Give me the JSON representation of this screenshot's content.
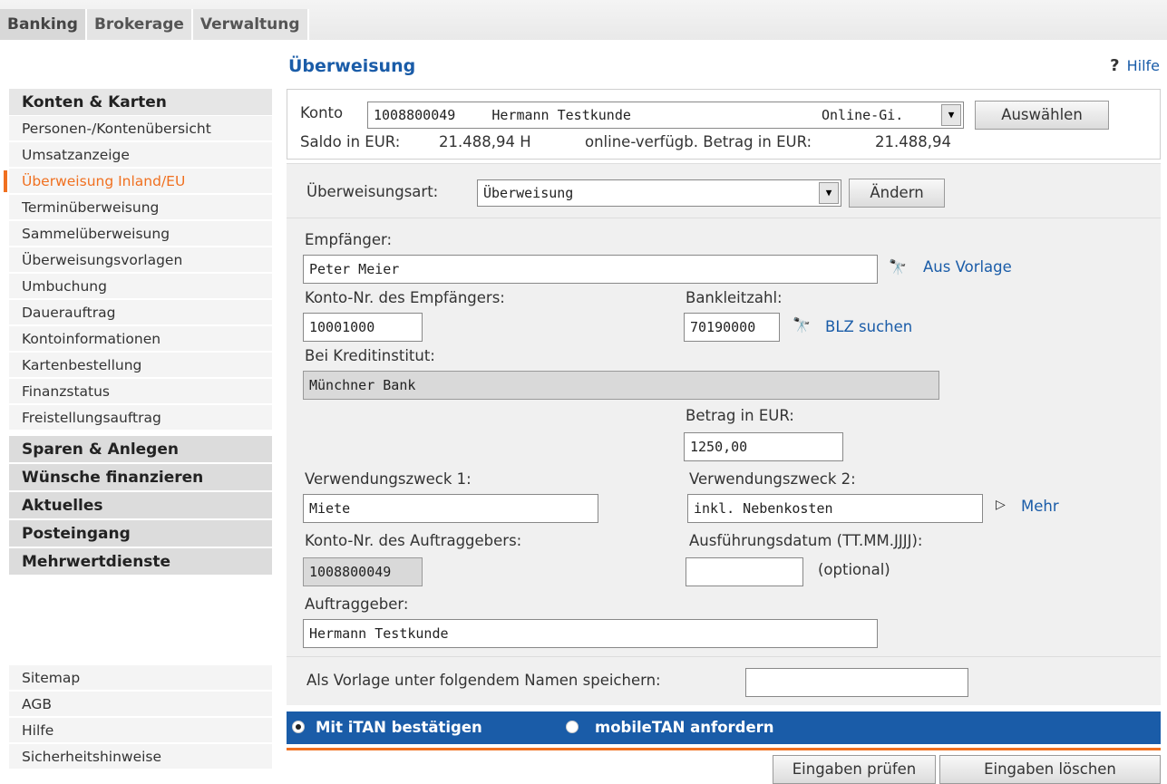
{
  "top_tabs": [
    "Banking",
    "Brokerage",
    "Verwaltung"
  ],
  "sidebar": {
    "category_konten": "Konten & Karten",
    "items": [
      "Personen-/Kontenübersicht",
      "Umsatzanzeige",
      "Überweisung Inland/EU",
      "Terminüberweisung",
      "Sammelüberweisung",
      "Überweisungsvorlagen",
      "Umbuchung",
      "Dauerauftrag",
      "Kontoinformationen",
      "Kartenbestellung",
      "Finanzstatus",
      "Freistellungsauftrag"
    ],
    "categories": [
      "Sparen & Anlegen",
      "Wünsche finanzieren",
      "Aktuelles",
      "Posteingang",
      "Mehrwertdienste"
    ],
    "footer_items": [
      "Sitemap",
      "AGB",
      "Hilfe",
      "Sicherheitshinweise"
    ]
  },
  "page": {
    "title": "Überweisung",
    "help": "Hilfe"
  },
  "konto": {
    "label": "Konto",
    "number": "1008800049",
    "name": "Hermann Testkunde",
    "type": "Online-Gi.",
    "select_button": "Auswählen",
    "saldo_label": "Saldo in EUR:",
    "saldo_value": "21.488,94 H",
    "verfuegbar_label": "online-verfügb. Betrag in EUR:",
    "verfuegbar_value": "21.488,94"
  },
  "art": {
    "label": "Überweisungsart:",
    "value": "Überweisung",
    "button": "Ändern"
  },
  "form": {
    "empfaenger_label": "Empfänger:",
    "empfaenger_value": "Peter Meier",
    "aus_vorlage": "Aus Vorlage",
    "kontonr_label": "Konto-Nr. des Empfängers:",
    "kontonr_value": "10001000",
    "blz_label": "Bankleitzahl:",
    "blz_value": "70190000",
    "blz_suchen": "BLZ suchen",
    "kreditinstitut_label": "Bei Kreditinstitut:",
    "kreditinstitut_value": "Münchner Bank",
    "betrag_label": "Betrag in EUR:",
    "betrag_value": "1250,00",
    "vz1_label": "Verwendungszweck 1:",
    "vz1_value": "Miete",
    "vz2_label": "Verwendungszweck 2:",
    "vz2_value": "inkl. Nebenkosten",
    "mehr": "Mehr",
    "auftraggeber_kto_label": "Konto-Nr. des Auftraggebers:",
    "auftraggeber_kto_value": "1008800049",
    "datum_label": "Ausführungsdatum (TT.MM.JJJJ):",
    "datum_value": "",
    "optional": "(optional)",
    "auftraggeber_label": "Auftraggeber:",
    "auftraggeber_value": "Hermann Testkunde"
  },
  "vorlage": {
    "label": "Als Vorlage unter folgendem Namen speichern:",
    "value": ""
  },
  "tan": {
    "option1": "Mit iTAN bestätigen",
    "option2": "mobileTAN anfordern",
    "selected": "option1"
  },
  "buttons": {
    "pruefen": "Eingaben prüfen",
    "loeschen": "Eingaben löschen"
  }
}
